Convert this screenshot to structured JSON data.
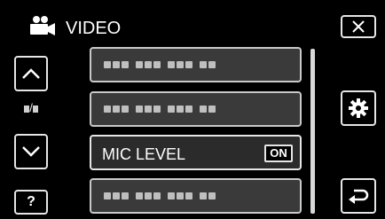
{
  "header": {
    "title": "VIDEO",
    "icon": "video-camera-icon"
  },
  "nav": {
    "up_icon": "chevron-up-icon",
    "down_icon": "chevron-down-icon",
    "page_separator": "/",
    "help_label": "?"
  },
  "actions": {
    "close_icon": "close-icon",
    "settings_icon": "gear-icon",
    "back_icon": "return-arrow-icon"
  },
  "menu": {
    "items": [
      {
        "label": "",
        "masked": true
      },
      {
        "label": "",
        "masked": true
      },
      {
        "label": "MIC LEVEL",
        "masked": false,
        "value": "ON"
      },
      {
        "label": "",
        "masked": true
      }
    ]
  },
  "colors": {
    "background": "#000000",
    "button_border": "#e6e6e6",
    "menu_item_bg": "#3a3a3a"
  }
}
